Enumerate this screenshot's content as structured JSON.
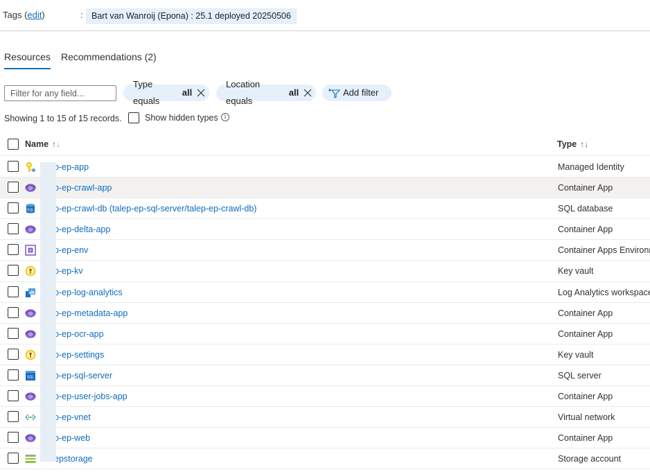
{
  "tags": {
    "label": "Tags",
    "edit_link": "edit",
    "colon": ":",
    "value": "Bart van Wanroij (Epona) : 25.1 deployed 20250506"
  },
  "tabs": [
    {
      "label": "Resources",
      "active": true
    },
    {
      "label": "Recommendations (2)",
      "active": false
    }
  ],
  "filters": {
    "search_placeholder": "Filter for any field...",
    "type": {
      "prefix": "Type equals",
      "value": "all"
    },
    "location": {
      "prefix": "Location equals",
      "value": "all"
    },
    "add_label": "Add filter"
  },
  "summary": {
    "showing": "Showing 1 to 15 of 15 records.",
    "show_hidden": "Show hidden types",
    "info": "i"
  },
  "grid": {
    "headers": {
      "name": "Name",
      "type": "Type"
    },
    "sort_glyphs": {
      "asc": "↑",
      "desc": "↓"
    },
    "rows": [
      {
        "name": "o-ep-app",
        "type": "Managed Identity",
        "icon": "managed-identity-icon"
      },
      {
        "name": "o-ep-crawl-app",
        "type": "Container App",
        "icon": "container-app-icon"
      },
      {
        "name": "o-ep-crawl-db (talep-ep-sql-server/talep-ep-crawl-db)",
        "type": "SQL database",
        "icon": "sql-database-icon"
      },
      {
        "name": "o-ep-delta-app",
        "type": "Container App",
        "icon": "container-app-icon"
      },
      {
        "name": "o-ep-env",
        "type": "Container Apps Environm",
        "icon": "container-apps-environment-icon"
      },
      {
        "name": "o-ep-kv",
        "type": "Key vault",
        "icon": "key-vault-icon"
      },
      {
        "name": "o-ep-log-analytics",
        "type": "Log Analytics workspace",
        "icon": "log-analytics-icon"
      },
      {
        "name": "o-ep-metadata-app",
        "type": "Container App",
        "icon": "container-app-icon"
      },
      {
        "name": "o-ep-ocr-app",
        "type": "Container App",
        "icon": "container-app-icon"
      },
      {
        "name": "o-ep-settings",
        "type": "Key vault",
        "icon": "key-vault-icon"
      },
      {
        "name": "o-ep-sql-server",
        "type": "SQL server",
        "icon": "sql-server-icon"
      },
      {
        "name": "o-ep-user-jobs-app",
        "type": "Container App",
        "icon": "container-app-icon"
      },
      {
        "name": "o-ep-vnet",
        "type": "Virtual network",
        "icon": "virtual-network-icon"
      },
      {
        "name": "o-ep-web",
        "type": "Container App",
        "icon": "container-app-icon"
      },
      {
        "name": "epstorage",
        "type": "Storage account",
        "icon": "storage-account-icon"
      }
    ]
  },
  "colors": {
    "accent": "#0f6cbd",
    "pill_bg": "#e5f0fb"
  }
}
